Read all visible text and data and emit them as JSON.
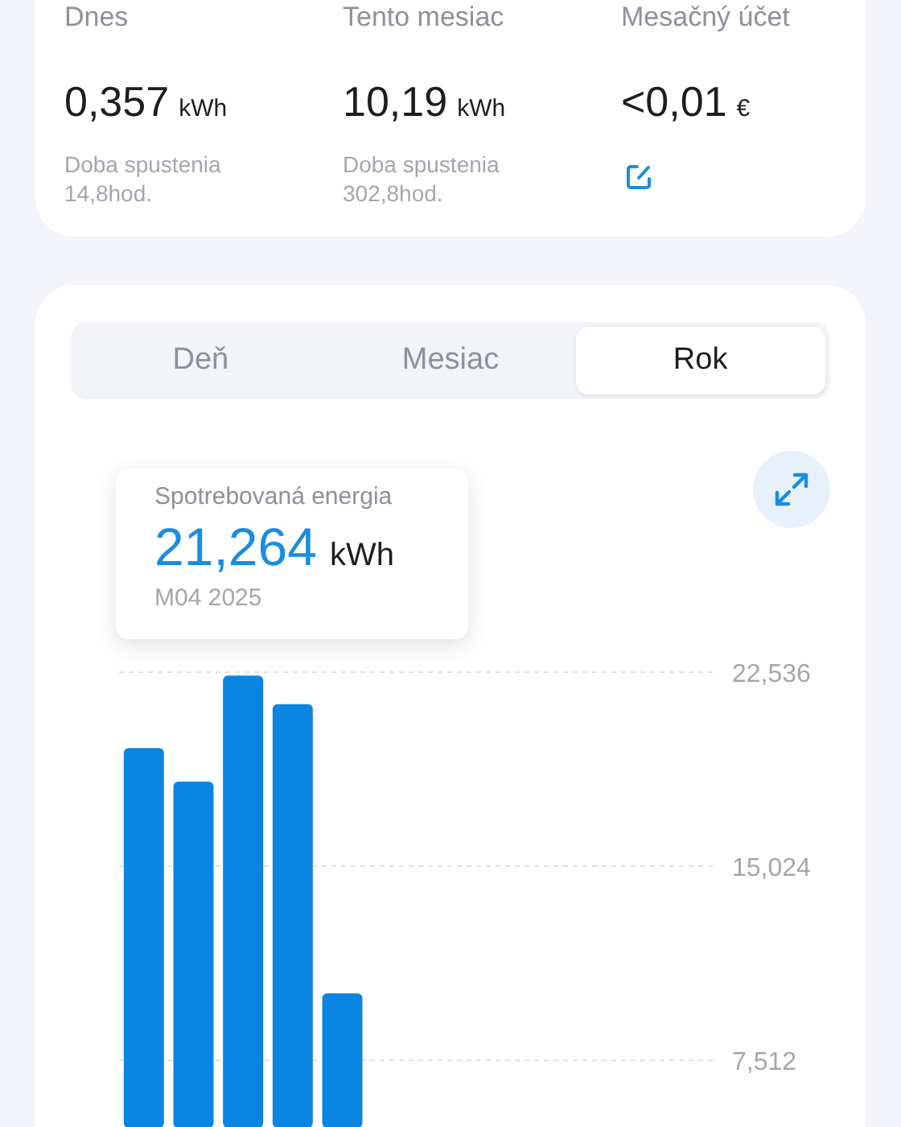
{
  "summary": [
    {
      "label": "Dnes",
      "value": "0,357",
      "unit": "kWh",
      "kind": "runtime",
      "note_lines": [
        "Doba spustenia",
        "14,8hod."
      ]
    },
    {
      "label": "Tento mesiac",
      "value": "10,19",
      "unit": "kWh",
      "kind": "runtime",
      "note_lines": [
        "Doba spustenia",
        "302,8hod."
      ]
    },
    {
      "label": "Mesačný účet",
      "value": "<0,01",
      "unit": "€",
      "kind": "edit"
    }
  ],
  "tabs": [
    {
      "label": "Deň",
      "selected": false
    },
    {
      "label": "Mesiac",
      "selected": false
    },
    {
      "label": "Rok",
      "selected": true
    }
  ],
  "tooltip": {
    "title": "Spotrebovaná energia",
    "value": "21,264",
    "unit": "kWh",
    "period": "M04 2025"
  },
  "chart_data": {
    "type": "bar",
    "ylim": [
      4.9,
      22.536
    ],
    "grid": true,
    "series": [
      {
        "color": "#0a86e2",
        "values": [
          19.6,
          18.3,
          22.4,
          21.3,
          10.1,
          null,
          null,
          null,
          null,
          null,
          null,
          null
        ]
      }
    ],
    "yticks": [
      {
        "value": 7.512,
        "label": "7,512"
      },
      {
        "value": 15.024,
        "label": "15,024"
      },
      {
        "value": 22.536,
        "label": "22,536"
      }
    ]
  }
}
